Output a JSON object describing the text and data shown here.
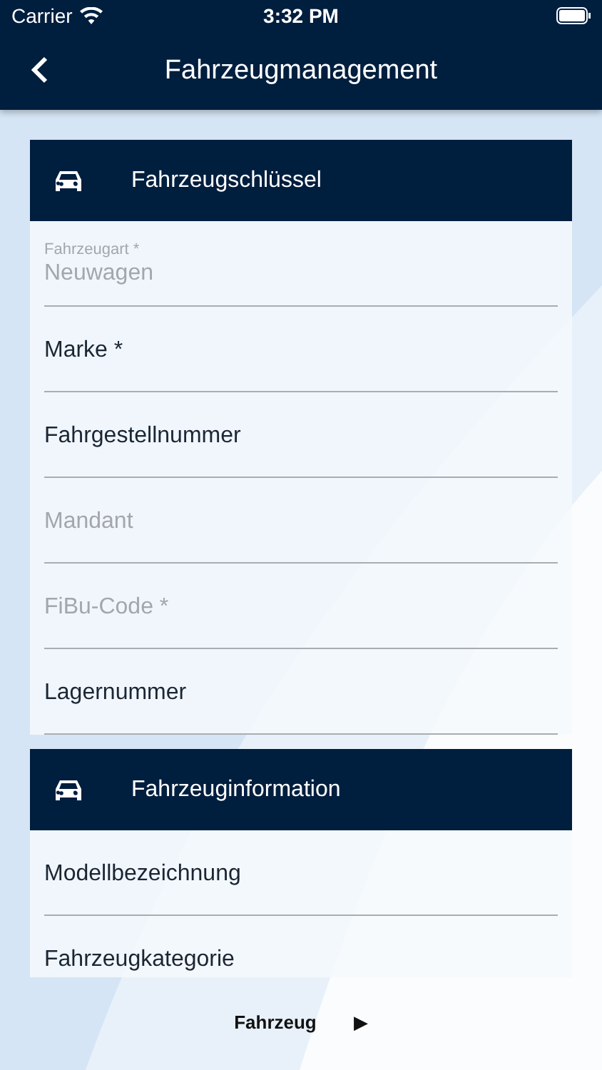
{
  "status_bar": {
    "carrier": "Carrier",
    "time": "3:32 PM"
  },
  "nav_bar": {
    "title": "Fahrzeugmanagement"
  },
  "sections": [
    {
      "title": "Fahrzeugschlüssel",
      "fields": [
        {
          "kind": "filled",
          "label": "Fahrzeugart *",
          "value": "Neuwagen",
          "disabled": true
        },
        {
          "kind": "empty",
          "placeholder": "Marke *",
          "disabled": false
        },
        {
          "kind": "empty",
          "placeholder": "Fahrgestellnummer",
          "disabled": false
        },
        {
          "kind": "empty",
          "placeholder": "Mandant",
          "disabled": true
        },
        {
          "kind": "empty",
          "placeholder": "FiBu-Code *",
          "disabled": true
        },
        {
          "kind": "empty",
          "placeholder": "Lagernummer",
          "disabled": false
        }
      ]
    },
    {
      "title": "Fahrzeuginformation",
      "fields": [
        {
          "kind": "empty",
          "placeholder": "Modellbezeichnung",
          "disabled": false
        },
        {
          "kind": "empty",
          "placeholder": "Fahrzeugkategorie",
          "disabled": false
        }
      ]
    }
  ],
  "footer": {
    "label": "Fahrzeug",
    "arrow": "▶"
  }
}
